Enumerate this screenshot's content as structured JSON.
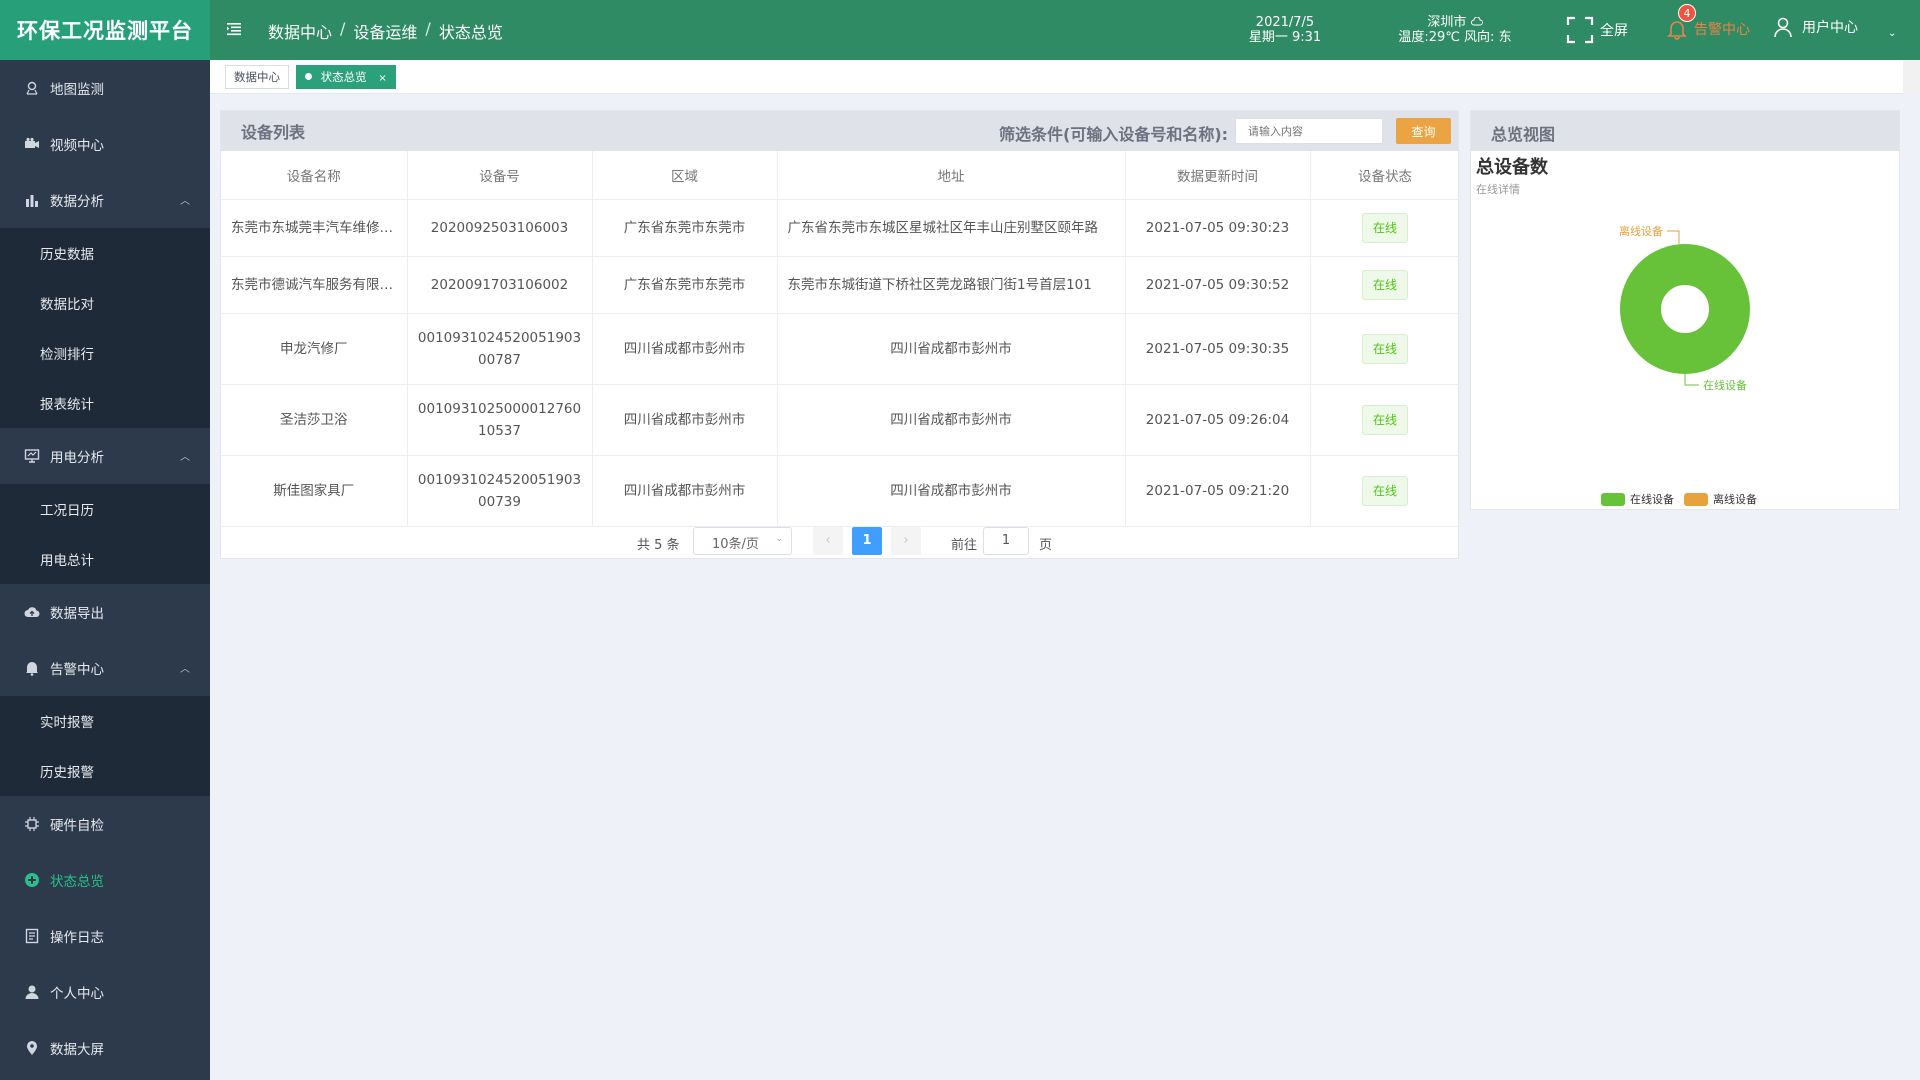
{
  "app": {
    "title": "环保工况监测平台"
  },
  "header": {
    "breadcrumb": [
      "数据中心",
      "设备运维",
      "状态总览"
    ],
    "date": "2021/7/5",
    "weekday_time": "星期一 9:31",
    "city": "深圳市",
    "weather": "温度:29℃ 风向: 东",
    "fullscreen_label": "全屏",
    "alarm_label": "告警中心",
    "alarm_count": "4",
    "user_label": "用户中心"
  },
  "sidebar": {
    "items": [
      {
        "label": "地图监测",
        "icon": "map-pin-icon"
      },
      {
        "label": "视频中心",
        "icon": "camera-icon"
      },
      {
        "label": "数据分析",
        "icon": "bar-chart-icon",
        "expanded": true,
        "children": [
          "历史数据",
          "数据比对",
          "检测排行",
          "报表统计"
        ]
      },
      {
        "label": "用电分析",
        "icon": "monitor-icon",
        "expanded": true,
        "children": [
          "工况日历",
          "用电总计"
        ]
      },
      {
        "label": "数据导出",
        "icon": "cloud-icon"
      },
      {
        "label": "告警中心",
        "icon": "bell-icon",
        "expanded": true,
        "children": [
          "实时报警",
          "历史报警"
        ]
      },
      {
        "label": "硬件自检",
        "icon": "chip-icon"
      },
      {
        "label": "状态总览",
        "icon": "plus-circle-icon",
        "active": true
      },
      {
        "label": "操作日志",
        "icon": "document-icon"
      },
      {
        "label": "个人中心",
        "icon": "person-icon"
      },
      {
        "label": "数据大屏",
        "icon": "location-icon"
      }
    ]
  },
  "tabs": [
    {
      "label": "数据中心",
      "active": false
    },
    {
      "label": "状态总览",
      "active": true,
      "close": "×"
    }
  ],
  "device_list": {
    "title": "设备列表",
    "filter_label": "筛选条件(可输入设备号和名称):",
    "filter_placeholder": "请输入内容",
    "query_button": "查询",
    "columns": [
      "设备名称",
      "设备号",
      "区域",
      "地址",
      "数据更新时间",
      "设备状态"
    ],
    "rows": [
      {
        "name": "东莞市东城莞丰汽车维修有限公司",
        "id": "2020092503106003",
        "region": "广东省东莞市东莞市",
        "address": "广东省东莞市东城区星城社区年丰山庄别墅区颐年路",
        "time": "2021-07-05 09:30:23",
        "status": "在线"
      },
      {
        "name": "东莞市德诚汽车服务有限公司",
        "id": "2020091703106002",
        "region": "广东省东莞市东莞市",
        "address": "东莞市东城街道下桥社区莞龙路银门街1号首层101",
        "time": "2021-07-05 09:30:52",
        "status": "在线"
      },
      {
        "name": "申龙汽修厂",
        "id": "001093102452005190300787",
        "region": "四川省成都市彭州市",
        "address": "四川省成都市彭州市",
        "time": "2021-07-05 09:30:35",
        "status": "在线"
      },
      {
        "name": "圣洁莎卫浴",
        "id": "001093102500001276010537",
        "region": "四川省成都市彭州市",
        "address": "四川省成都市彭州市",
        "time": "2021-07-05 09:26:04",
        "status": "在线"
      },
      {
        "name": "斯佳图家具厂",
        "id": "001093102452005190300739",
        "region": "四川省成都市彭州市",
        "address": "四川省成都市彭州市",
        "time": "2021-07-05 09:21:20",
        "status": "在线"
      }
    ],
    "pagination": {
      "total": "共 5 条",
      "page_size": "10条/页",
      "current_page": "1",
      "goto_label": "前往",
      "goto_value": "1",
      "page_suffix": "页",
      "prev": "‹",
      "next": "›"
    }
  },
  "overview": {
    "panel_title": "总览视图",
    "title": "总设备数",
    "subtitle": "在线详情",
    "label_offline": "离线设备",
    "label_online": "在线设备"
  },
  "chart_data": {
    "type": "pie",
    "title": "总设备数",
    "subtitle": "在线详情",
    "categories": [
      "在线设备",
      "离线设备"
    ],
    "values": [
      5,
      0
    ],
    "colors": [
      "#67c23a",
      "#e6a23c"
    ],
    "legend_position": "bottom"
  },
  "colors": {
    "header": "#2e8b64",
    "logo_bg": "#27a07a",
    "sidebar": "#2c3a4c",
    "sidebar_active": "#29c18a",
    "query_button": "#eba444",
    "online": "#67c23a",
    "offline": "#e6a23c"
  }
}
